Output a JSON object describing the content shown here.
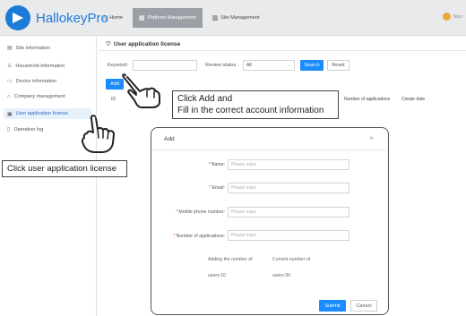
{
  "app": {
    "logo_text": "HallokeyPro",
    "nav": [
      {
        "label": "Home",
        "icon": "⌂"
      },
      {
        "label": "Platform Management",
        "icon": "▦"
      },
      {
        "label": "Site Management",
        "icon": "▥"
      }
    ],
    "user_name": "Nico"
  },
  "sidebar": {
    "items": [
      {
        "label": "Site information",
        "icon": "▤"
      },
      {
        "label": "Household information",
        "icon": "♙"
      },
      {
        "label": "Device information",
        "icon": "▭"
      },
      {
        "label": "Company management",
        "icon": "⌂"
      },
      {
        "label": "User application license",
        "icon": "▣"
      },
      {
        "label": "Operation log",
        "icon": "▯"
      }
    ]
  },
  "main": {
    "title": "User application license",
    "title_icon": "♡",
    "keyword_label": "Keyword:",
    "review_label": "Review status :",
    "review_value": "All",
    "search_label": "Search",
    "reset_label": "Reset",
    "add_label": "Add",
    "table_headers": [
      "ID",
      "Number of applications",
      "Create date"
    ]
  },
  "callouts": {
    "add": [
      "Click Add and",
      "Fill in the correct account information"
    ],
    "license": "Click user application license"
  },
  "modal": {
    "title": "Add",
    "close": "×",
    "fields": [
      {
        "label": "Name:",
        "placeholder": "Please input"
      },
      {
        "label": "Email:",
        "placeholder": "Please input"
      },
      {
        "label": "Mobile phone number:",
        "placeholder": "Please input"
      },
      {
        "label": "Number of applications:",
        "placeholder": "Please input"
      }
    ],
    "adding_label": "Adding the number of",
    "adding_value": "users:10",
    "current_label": "Current number of",
    "current_value": "users:30",
    "submit_label": "Submit",
    "cancel_label": "Cancel"
  },
  "colors": {
    "primary": "#1a8cff",
    "brand": "#1d7bd8",
    "required": "#e53935"
  }
}
